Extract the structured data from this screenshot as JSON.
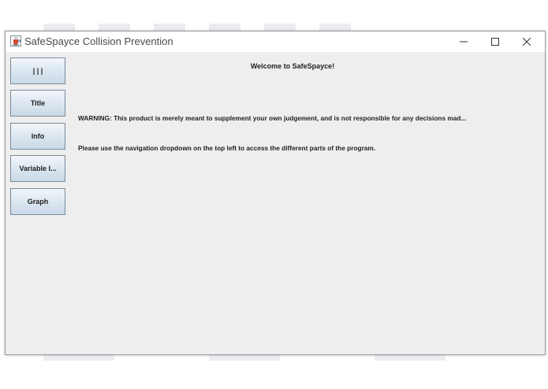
{
  "window": {
    "title": "SafeSpayce Collision Prevention",
    "minimize_label": "—",
    "maximize_label": "☐",
    "close_label": "✕"
  },
  "nav": {
    "items": [
      {
        "label": "| | |"
      },
      {
        "label": "Title"
      },
      {
        "label": "Info"
      },
      {
        "label": "Variable I..."
      },
      {
        "label": "Graph"
      }
    ]
  },
  "main": {
    "welcome": "Welcome to SafeSpayce!",
    "warning": "WARNING: This product is merely meant to supplement your own judgement, and is not responsible for any decisions mad...",
    "instructions": "Please use the navigation dropdown on the top left to access the different parts of the program."
  },
  "colors": {
    "window_bg": "#eeeeee",
    "titlebar_bg": "#ffffff",
    "button_border": "#7a8a99"
  },
  "icons": {
    "app": "java-cup-icon",
    "minimize": "minimize-icon",
    "maximize": "maximize-icon",
    "close": "close-icon"
  }
}
